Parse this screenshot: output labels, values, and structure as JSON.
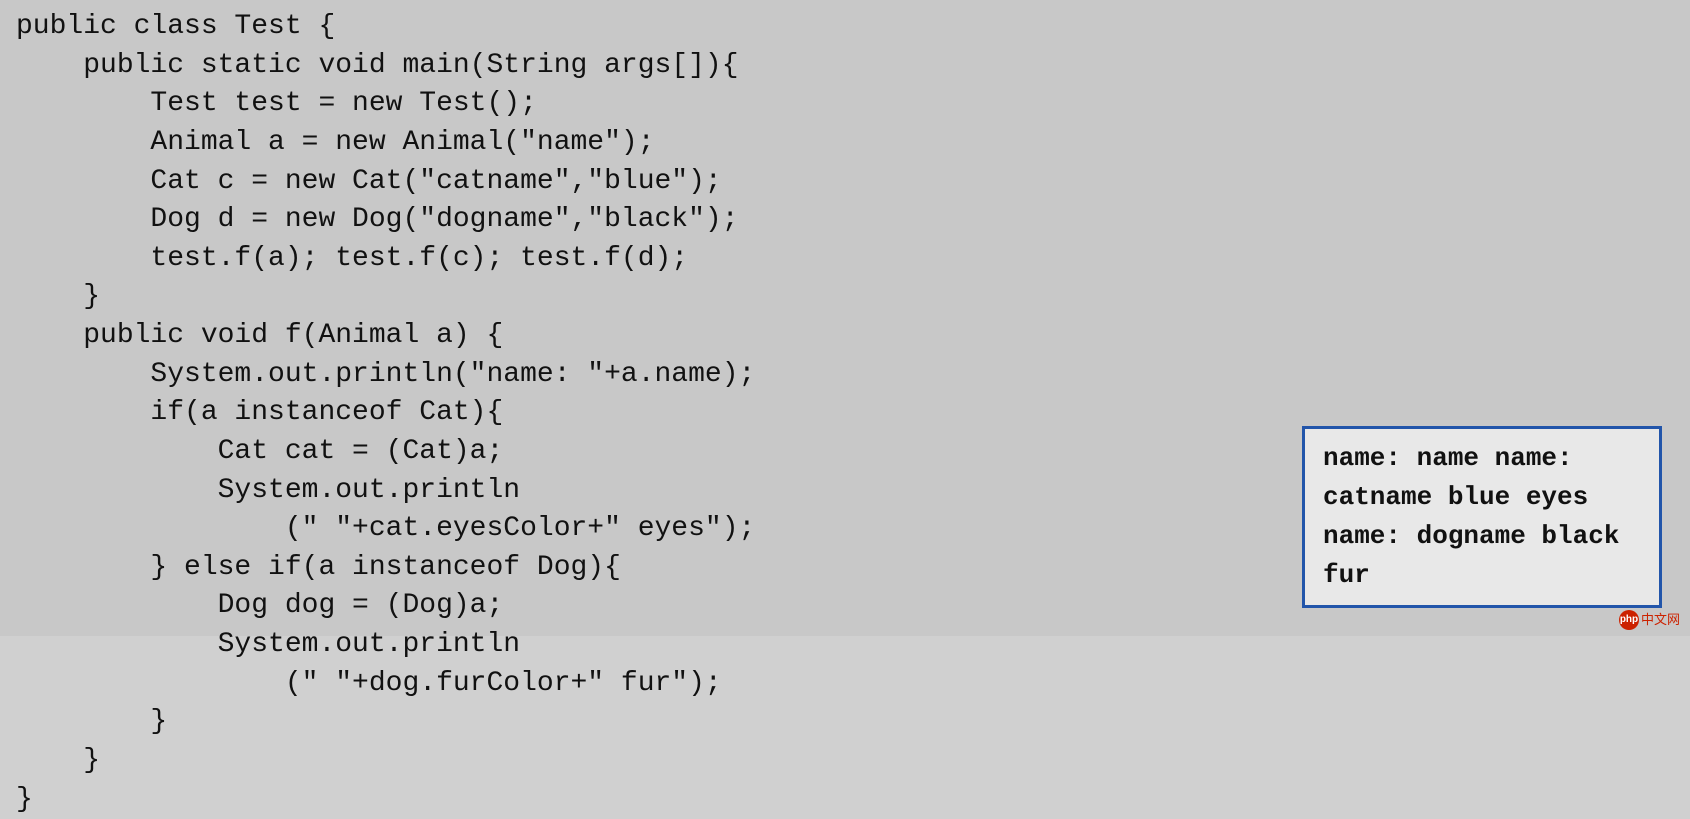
{
  "code": {
    "lines": [
      "public class Test {",
      "    public static void main(String args[]){",
      "        Test test = new Test();",
      "        Animal a = new Animal(\"name\");",
      "        Cat c = new Cat(\"catname\",\"blue\");",
      "        Dog d = new Dog(\"dogname\",\"black\");",
      "        test.f(a); test.f(c); test.f(d);",
      "    }",
      "    public void f(Animal a) {",
      "        System.out.println(\"name: \"+a.name);",
      "        if(a instanceof Cat){",
      "            Cat cat = (Cat)a;",
      "            System.out.println",
      "                (\" \"+cat.eyesColor+\" eyes\");",
      "        } else if(a instanceof Dog){",
      "            Dog dog = (Dog)a;",
      "            System.out.println",
      "                (\" \"+dog.furColor+\" fur\");",
      "        }",
      "    }",
      "}"
    ]
  },
  "output": {
    "lines": [
      "name:  name",
      "name:  catname",
      " blue eyes",
      "name:  dogname",
      " black fur"
    ]
  },
  "watermark": {
    "text": "中文网",
    "circle_text": "php"
  }
}
